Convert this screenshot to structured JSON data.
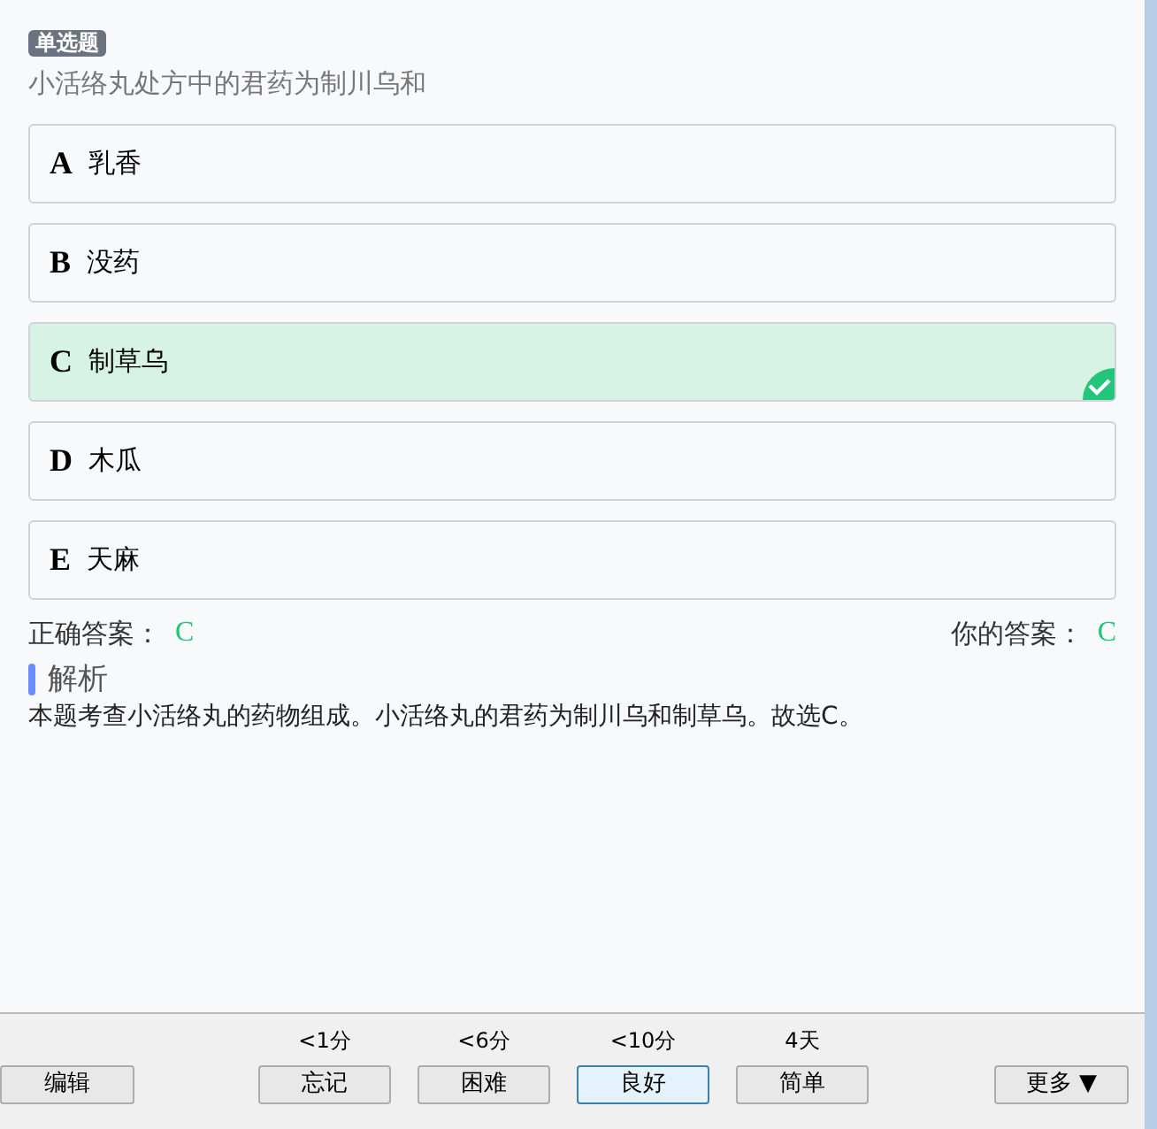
{
  "question": {
    "type_badge": "单选题",
    "text": "小活络丸处方中的君药为制川乌和"
  },
  "options": [
    {
      "letter": "A",
      "text": "乳香",
      "selected": false
    },
    {
      "letter": "B",
      "text": "没药",
      "selected": false
    },
    {
      "letter": "C",
      "text": "制草乌",
      "selected": true
    },
    {
      "letter": "D",
      "text": "木瓜",
      "selected": false
    },
    {
      "letter": "E",
      "text": "天麻",
      "selected": false
    }
  ],
  "answers": {
    "correct_label": "正确答案：",
    "correct_value": "C",
    "yours_label": "你的答案：",
    "yours_value": "C"
  },
  "analysis": {
    "heading": "解析",
    "text": "本题考查小活络丸的药物组成。小活络丸的君药为制川乌和制草乌。故选C。"
  },
  "toolbar": {
    "edit_button": "编辑",
    "more_button": "更多 ▼",
    "ratings": [
      {
        "interval": "<1分",
        "label": "忘记",
        "selected": false
      },
      {
        "interval": "<6分",
        "label": "困难",
        "selected": false
      },
      {
        "interval": "<10分",
        "label": "良好",
        "selected": true
      },
      {
        "interval": "4天",
        "label": "简单",
        "selected": false
      }
    ]
  }
}
